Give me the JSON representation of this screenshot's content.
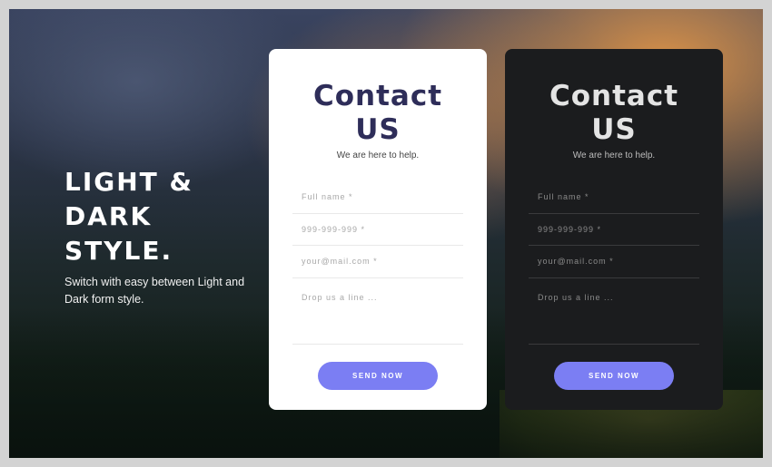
{
  "hero": {
    "title": "LIGHT &\nDARK\nSTYLE.",
    "subtitle": "Switch with easy between Light and Dark form style."
  },
  "light_form": {
    "title": "Contact US",
    "subtitle": "We are here to help.",
    "name_placeholder": "Full name *",
    "phone_placeholder": "999-999-999 *",
    "email_placeholder": "your@mail.com *",
    "message_placeholder": "Drop us a line ...",
    "button_label": "SEND NOW"
  },
  "dark_form": {
    "title": "Contact US",
    "subtitle": "We are here to help.",
    "name_placeholder": "Full name *",
    "phone_placeholder": "999-999-999 *",
    "email_placeholder": "your@mail.com *",
    "message_placeholder": "Drop us a line ...",
    "button_label": "SEND NOW"
  },
  "colors": {
    "accent": "#7b7ef3",
    "light_title": "#2e2d59",
    "dark_card": "#1b1c1e"
  }
}
